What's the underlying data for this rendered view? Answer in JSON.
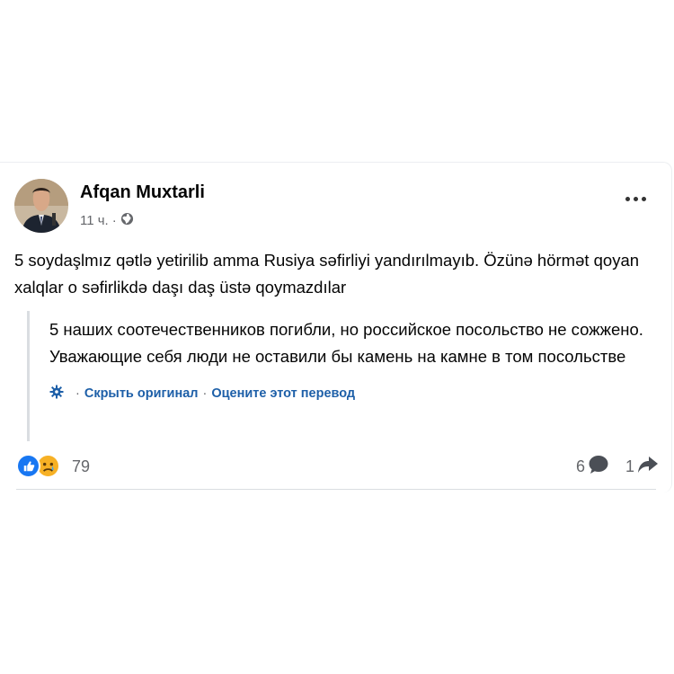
{
  "post": {
    "author": "Afqan Muxtarli",
    "time": "11 ч.",
    "separator": "·",
    "text": "5 soydaşlmız qətlə yetirilib amma Rusiya səfirliyi yandırılmayıb. Özünə hörmət qoyan xalqlar o səfirlikdə daşı daş üstə qoymazdılar",
    "translation": "5 наших соотечественников погибли, но российское посольство не сожжено. Уважающие себя люди не оставили бы камень на камне в том посольстве",
    "hide_original_label": "Скрыть оригинал",
    "link_separator": "·",
    "rate_translation_label": "Оцените этот перевод",
    "reaction_count": "79",
    "comment_count": "6",
    "share_count": "1",
    "reactions": [
      "like-icon",
      "sad-icon"
    ],
    "icons": [
      "globe-icon",
      "more-options-icon",
      "translate-gear-icon",
      "comment-icon",
      "share-icon"
    ]
  },
  "colors": {
    "link": "#1d5fa8",
    "meta_text": "#65676b",
    "like": "#1877f2",
    "sad": "#f7b125"
  }
}
